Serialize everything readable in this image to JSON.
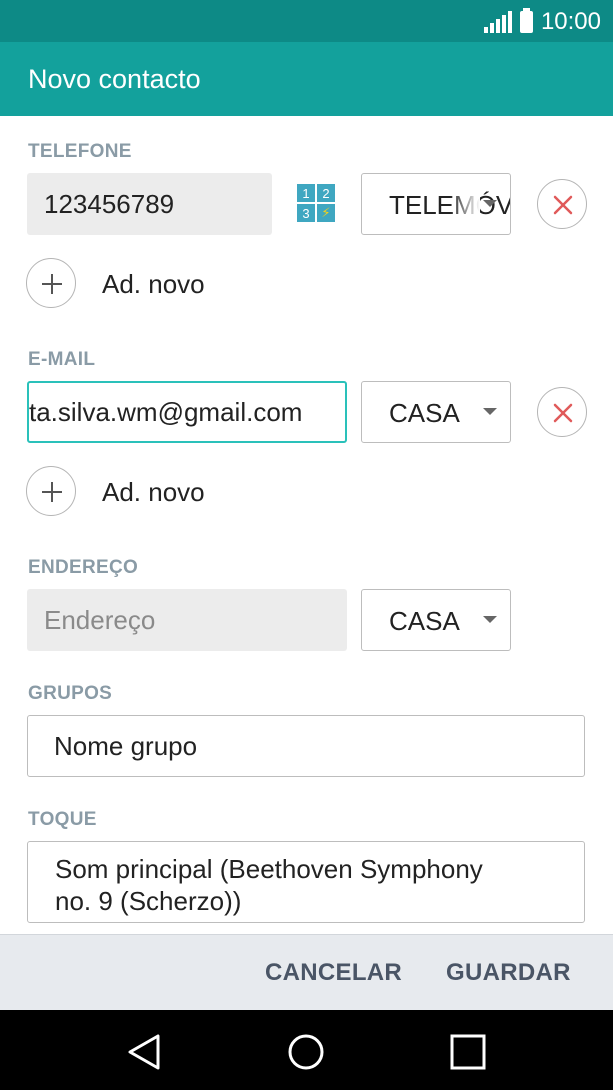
{
  "status_bar": {
    "time": "10:00"
  },
  "app_bar": {
    "title": "Novo contacto"
  },
  "phone": {
    "label": "TELEFONE",
    "value": "123456789",
    "type": "TELEMÓVEL",
    "keypad_digits": [
      "1",
      "2",
      "3",
      "⚡"
    ],
    "add_new": "Ad. novo"
  },
  "email": {
    "label": "E-MAIL",
    "value": "ta.silva.wm@gmail.com",
    "type": "CASA",
    "add_new": "Ad. novo"
  },
  "address": {
    "label": "ENDEREÇO",
    "placeholder": "Endereço",
    "type": "CASA"
  },
  "groups": {
    "label": "GRUPOS",
    "value": "Nome grupo"
  },
  "ringtone": {
    "label": "TOQUE",
    "value": "Som principal (Beethoven Symphony no. 9 (Scherzo))"
  },
  "actions": {
    "cancel": "CANCELAR",
    "save": "GUARDAR"
  },
  "colors": {
    "status_bar": "#0d8a86",
    "app_bar": "#13a19c",
    "focus_border": "#2ac1ba",
    "remove_icon": "#e05a5a",
    "section_label": "#8a9ba6"
  }
}
